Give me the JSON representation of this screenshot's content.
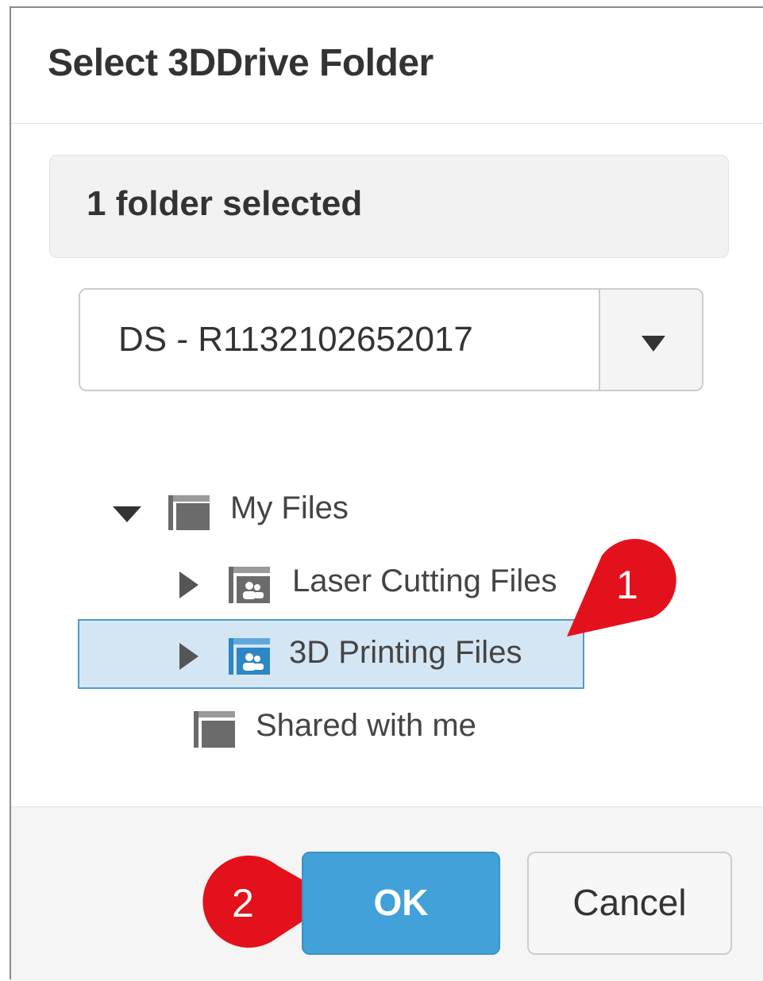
{
  "dialog": {
    "title": "Select 3DDrive Folder",
    "selection_status": "1 folder selected"
  },
  "drive_select": {
    "value": "DS - R1132102652017",
    "caret_icon": "caret-down-icon"
  },
  "tree": {
    "items": [
      {
        "label": "My Files",
        "expanded": true,
        "toggle_icon": "caret-down-icon",
        "icon": "folder-icon"
      },
      {
        "label": "Laser Cutting Files",
        "expanded": false,
        "toggle_icon": "caret-right-icon",
        "icon": "shared-folder-icon"
      },
      {
        "label": "3D Printing Files",
        "expanded": false,
        "selected": true,
        "toggle_icon": "caret-right-icon",
        "icon": "shared-folder-icon"
      },
      {
        "label": "Shared with me",
        "icon": "folder-icon"
      }
    ]
  },
  "buttons": {
    "ok_label": "OK",
    "cancel_label": "Cancel"
  },
  "callouts": {
    "step1": "1",
    "step2": "2"
  },
  "colors": {
    "primary": "#42a1d8",
    "selection": "#d4e6f3",
    "selection_border": "#4c9bd3",
    "callout": "#e3111b"
  }
}
